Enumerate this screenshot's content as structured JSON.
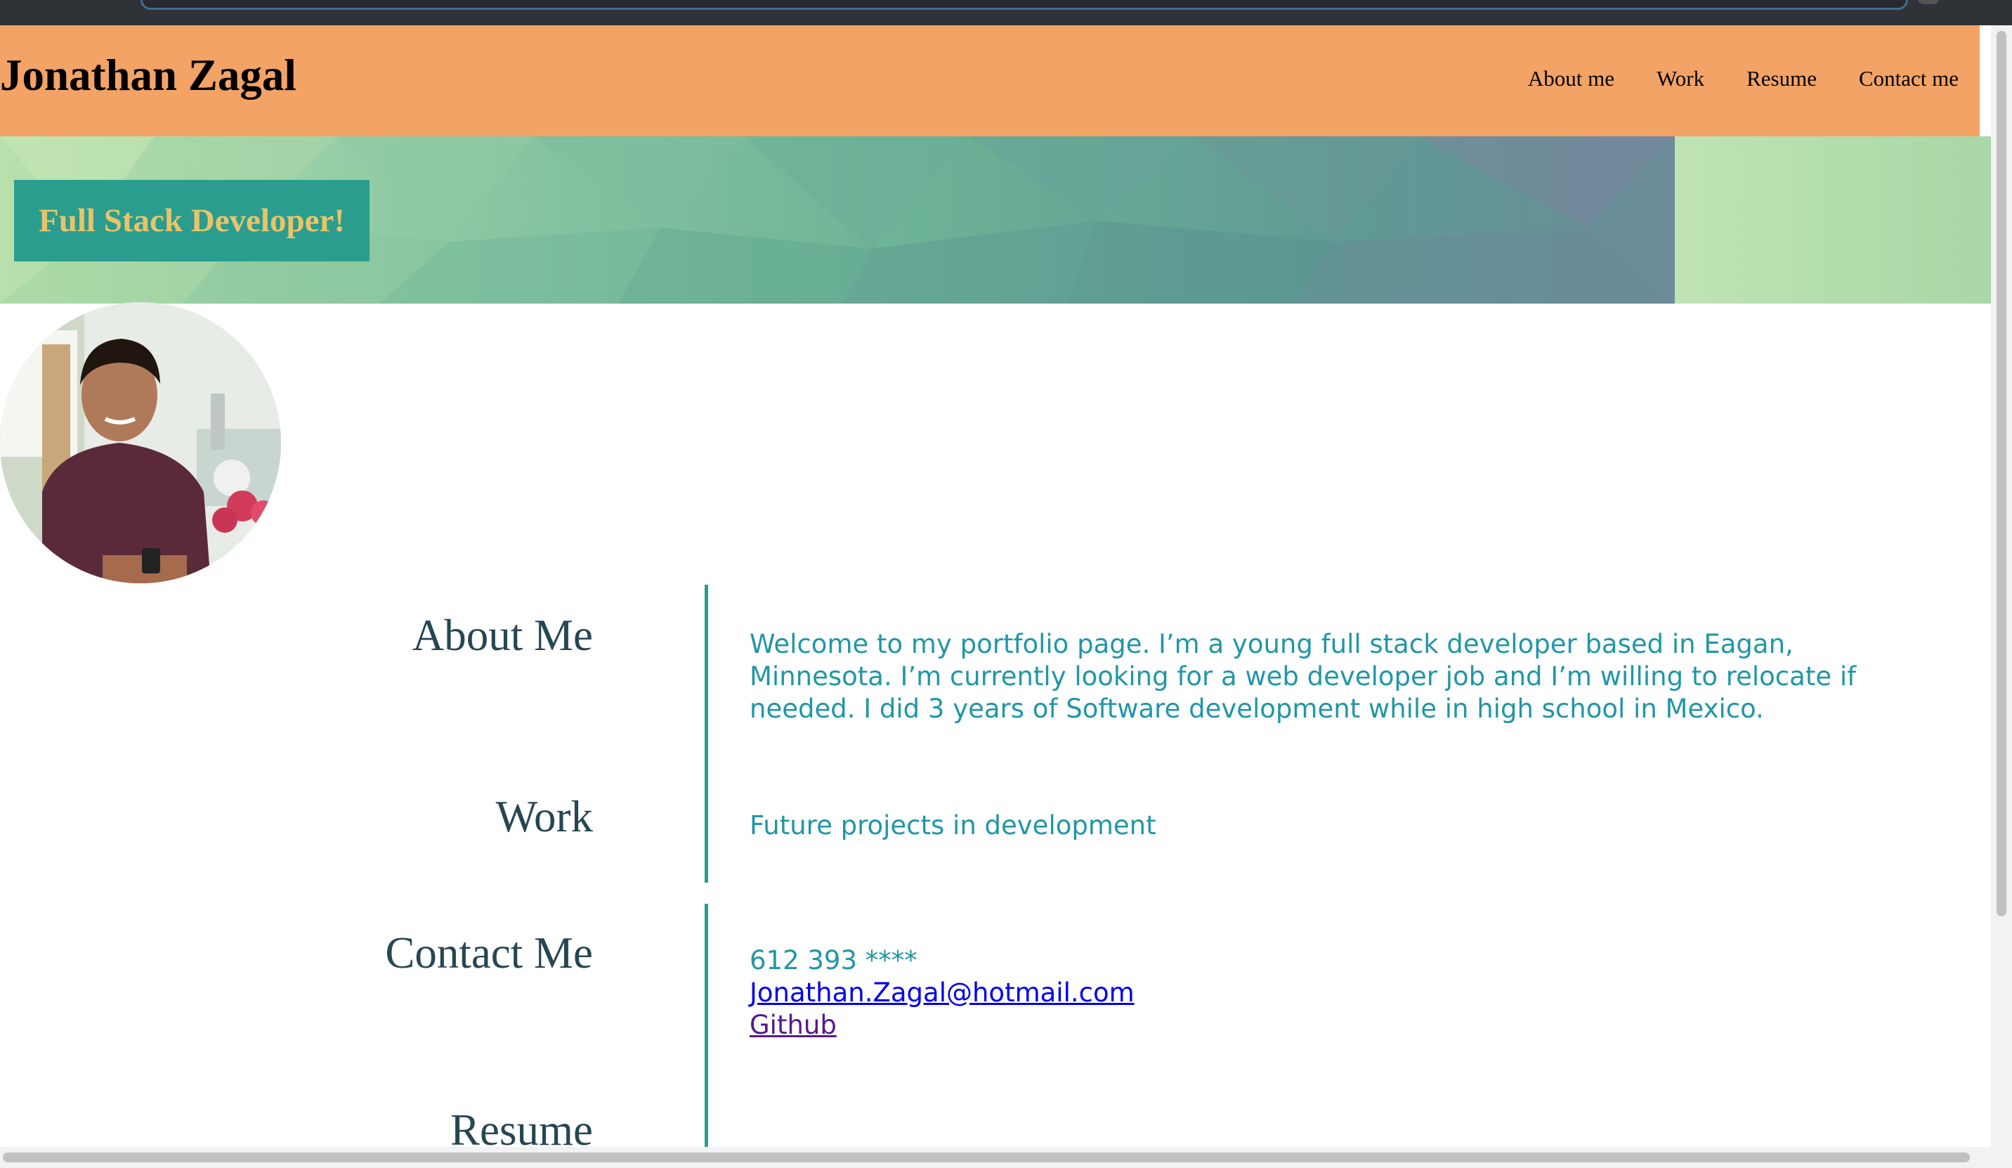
{
  "header": {
    "title": "Jonathan Zagal",
    "nav": [
      "About me",
      "Work",
      "Resume",
      "Contact me"
    ]
  },
  "hero": {
    "badge": "Full Stack Developer!"
  },
  "avatar": {
    "icon": "profile-photo"
  },
  "sections": {
    "about": {
      "title": "About Me",
      "text": "Welcome to my portfolio page. I’m a young full stack developer based in Eagan, Minnesota. I’m currently looking for a web developer job and I’m willing to relocate if needed. I did 3 years of Software development while in high school in Mexico."
    },
    "work": {
      "title": "Work",
      "text": "Future projects in development"
    },
    "contact": {
      "title": "Contact Me",
      "phone": "612 393 ****",
      "email": "Jonathan.Zagal@hotmail.com",
      "github": "Github"
    },
    "resume": {
      "title": "Resume"
    }
  },
  "colors": {
    "header": "#f3a366",
    "badge_bg": "#2a9d8f",
    "badge_text": "#e9c46a",
    "heading": "#264653",
    "body_text": "#2196a6"
  }
}
